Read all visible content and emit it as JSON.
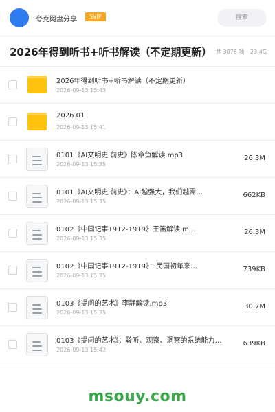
{
  "header": {
    "site_name": "夸克网盘分享",
    "vip_badge": "SVIP",
    "search_label": "搜索"
  },
  "title": "2026年得到听书+听书解读（不定期更新）",
  "summary": {
    "count": "共 3076 项",
    "separator": "·",
    "size": "23.4G"
  },
  "files": [
    {
      "type": "folder",
      "name": "2026年得到听书+听书解读（不定期更新）",
      "date": "2026-09-13 15:43",
      "size": ""
    },
    {
      "type": "folder",
      "name": "2026.01",
      "date": "2026-09-13 15:41",
      "size": ""
    },
    {
      "type": "file",
      "name": "0101《AI文明史·前史》陈章鱼解读.mp3",
      "date": "2026-09-13 15:35",
      "size": "26.3M"
    },
    {
      "type": "file",
      "name": "0101《AI文明史·前史》：AI越强大，我们越需…",
      "date": "2026-09-13 15:35",
      "size": "662KB"
    },
    {
      "type": "file",
      "name": "0102《中国记事1912-1919》王笛解读.m…",
      "date": "2026-09-13 15:35",
      "size": "26.3M"
    },
    {
      "type": "file",
      "name": "0102《中国记事1912-1919》：民国初年来…",
      "date": "2026-09-13 15:35",
      "size": "739KB"
    },
    {
      "type": "file",
      "name": "0103《提问的艺术》李静解读.mp3",
      "date": "2026-09-13 15:35",
      "size": "30.7M"
    },
    {
      "type": "file",
      "name": "0103《提问的艺术》：聆听、观察、洞察的系统能力…",
      "date": "2026-09-13 15:42",
      "size": "639KB"
    }
  ],
  "watermark": "msouy.com",
  "colors": {
    "accent": "#2f7bf0",
    "vip": "#f5a623",
    "folder": "#ffc20e",
    "watermark": "#3aa84a"
  }
}
